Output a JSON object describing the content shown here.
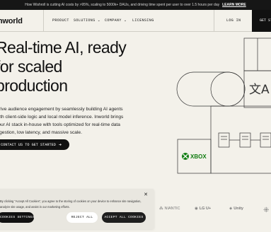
{
  "banner": {
    "text": "How Wishroll is cutting AI costs by >95%, scaling to 5000k+ DAUs, and driving time spent per user to over 1.5 hours per day",
    "link": "LEARN MORE"
  },
  "nav": {
    "logo": "Inworld",
    "product": "PRODUCT",
    "solutions": "SOLUTIONS",
    "company": "COMPANY",
    "licensing": "LICENSING",
    "login": "LOG IN",
    "get_started": "GET STARTED"
  },
  "hero": {
    "title_lines": [
      "Real-time AI, ready",
      "for scaled",
      "production"
    ],
    "description_lines": [
      "Drive audience engagement by seamlessly building AI agents",
      "with client-side logic and local model inference. Inworld brings",
      "your AI stack in-house with tools optimized for real-time data",
      "ingestion, low latency, and massive scale."
    ],
    "cta": "CONTACT US TO GET STARTED"
  },
  "diagram": {
    "xbox_label": "XBOX",
    "translate_glyphs": "文A"
  },
  "partner_logos": [
    "NIANTIC",
    "LG U+",
    "Unity"
  ],
  "cookie": {
    "text_lines": [
      "By clicking “Accept All Cookies”, you agree to the storing of cookies on your device to enhance site navigation,",
      "analyze site usage, and assist in our marketing efforts."
    ],
    "settings": "COOKIES SETTINGS",
    "reject": "REJECT ALL",
    "accept": "ACCEPT ALL COOKIES"
  },
  "colors": {
    "background": "#f3f1ea",
    "dark": "#111111",
    "xbox_green": "#107c10"
  }
}
